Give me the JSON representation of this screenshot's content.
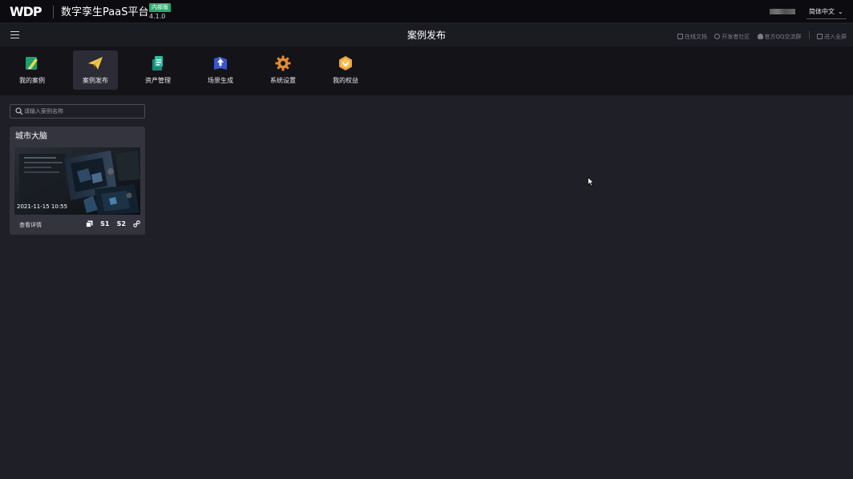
{
  "header": {
    "logo_text": "WDP",
    "app_title": "数字孪生PaaS平台",
    "badge": "内部版",
    "version": "4.1.0",
    "language": "简体中文"
  },
  "subbar": {
    "page_title": "案例发布",
    "links": [
      {
        "label": "在线文档",
        "icon": "document-icon"
      },
      {
        "label": "开发者社区",
        "icon": "community-icon"
      },
      {
        "label": "官方QQ交流群",
        "icon": "qq-icon"
      },
      {
        "label": "进入全屏",
        "icon": "fullscreen-icon"
      }
    ]
  },
  "toolbar": {
    "items": [
      {
        "label": "我的案例",
        "icon": "my-cases-icon",
        "active": false
      },
      {
        "label": "案例发布",
        "icon": "paper-plane-icon",
        "active": true
      },
      {
        "label": "资产管理",
        "icon": "asset-icon",
        "active": false
      },
      {
        "label": "场景生成",
        "icon": "scene-generate-icon",
        "active": false
      },
      {
        "label": "系统设置",
        "icon": "gear-icon",
        "active": false
      },
      {
        "label": "我的权益",
        "icon": "rights-icon",
        "active": false
      }
    ]
  },
  "search": {
    "placeholder": "请输入案例名称",
    "value": ""
  },
  "cards": [
    {
      "title": "城市大脑",
      "date": "2021-11-15 10:55",
      "detail_label": "查看详情",
      "actions": [
        "copy-icon",
        "S1",
        "S2",
        "link-icon"
      ]
    }
  ],
  "colors": {
    "accent_green": "#2aa86a",
    "background": "#1f1f28",
    "topbar": "#0c0c10",
    "card": "#34343f"
  }
}
